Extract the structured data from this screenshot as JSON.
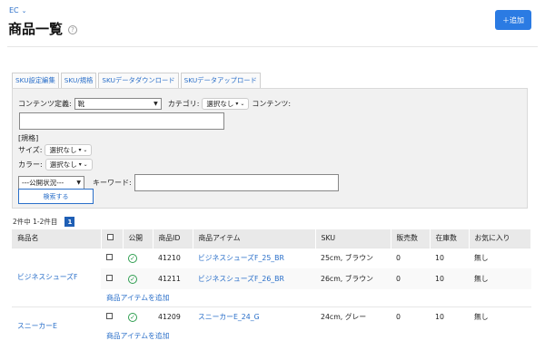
{
  "breadcrumb": "EC",
  "page_title": "商品一覧",
  "add_button": "＋追加",
  "tabs": [
    "SKU設定編集",
    "SKU/規格",
    "SKUデータダウンロード",
    "SKUデータアップロード"
  ],
  "filters": {
    "contents_label": "コンテンツ定義:",
    "contents_value": "靴",
    "category_label": "カテゴリ:",
    "category_value": "選択なし",
    "contents2_label": "コンテンツ:",
    "spec_label": "[規格]",
    "size_label": "サイズ:",
    "size_value": "選択なし",
    "color_label": "カラー:",
    "color_value": "選択なし",
    "status_value": "---公開状況---",
    "keyword_label": "キーワード:",
    "search_button": "検索する"
  },
  "pagination": {
    "summary": "2件中 1-2件目",
    "current_page": "1"
  },
  "table": {
    "headers": [
      "商品名",
      "",
      "公開",
      "商品ID",
      "商品アイテム",
      "SKU",
      "販売数",
      "在庫数",
      "お気に入り"
    ],
    "products": [
      {
        "name": "ビジネスシューズF",
        "items": [
          {
            "id": "41210",
            "item": "ビジネスシューズF_25_BR",
            "sku": "25cm, ブラウン",
            "sales": "0",
            "stock": "10",
            "fav": "無し"
          },
          {
            "id": "41211",
            "item": "ビジネスシューズF_26_BR",
            "sku": "26cm, ブラウン",
            "sales": "0",
            "stock": "10",
            "fav": "無し"
          }
        ],
        "add_item": "商品アイテムを追加"
      },
      {
        "name": "スニーカーE",
        "items": [
          {
            "id": "41209",
            "item": "スニーカーE_24_G",
            "sku": "24cm, グレー",
            "sales": "0",
            "stock": "10",
            "fav": "無し"
          }
        ],
        "add_item": "商品アイテムを追加"
      }
    ]
  }
}
